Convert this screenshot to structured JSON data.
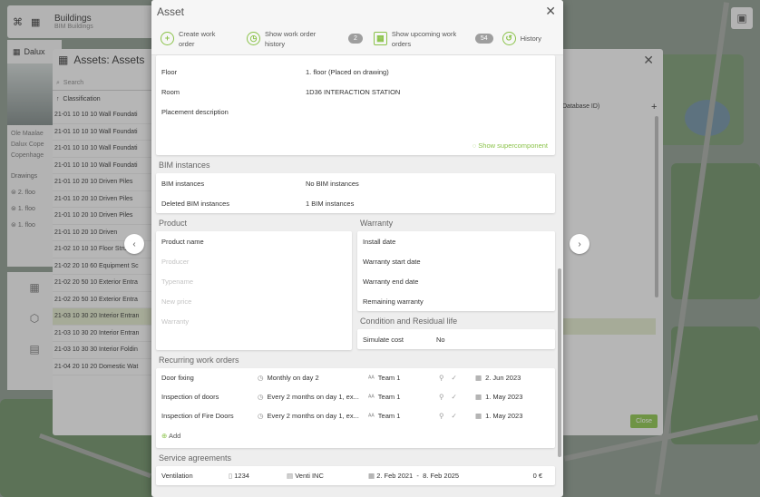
{
  "app": {
    "building_title": "Buildings",
    "building_subtitle": "BIM Buildings"
  },
  "left_panel": {
    "title": "Dalux",
    "info_lines": [
      "Ole Maalae",
      "Dalux Cope",
      "Copenhage"
    ],
    "drawings_label": "Drawings",
    "drawing_items": [
      "2. floo",
      "1. floo",
      "1. floo"
    ]
  },
  "assets_panel": {
    "title": "Assets: Assets",
    "search_placeholder": "Search",
    "column_classification": "Classification",
    "column_db": "Database ID)",
    "close_label": "Close",
    "rows": [
      "21-01 10 10 10 Wall Foundati",
      "21-01 10 10 10 Wall Foundati",
      "21-01 10 10 10 Wall Foundati",
      "21-01 10 10 10 Wall Foundati",
      "21-01 10 20 10 Driven Piles",
      "21-01 10 20 10 Driven Piles",
      "21-01 10 20 10 Driven Piles",
      "21-01 10 20 10 Driven",
      "21-02 10 10 10 Floor Structur",
      "21-02 20 10 60 Equipment Sc",
      "21-02 20 50 10 Exterior Entra",
      "21-02 20 50 10 Exterior Entra",
      "21-03 10 30 20 Interior Entran",
      "21-03 10 30 20 Interior Entran",
      "21-03 10 30 30 Interior Foldin",
      "21-04 20 10 20 Domestic Wat"
    ],
    "selected_row_index": 12
  },
  "modal": {
    "title": "Asset",
    "actions": {
      "create_wo": "Create work order",
      "show_history": "Show work order history",
      "history_count": "2",
      "upcoming": "Show upcoming work orders",
      "upcoming_count": "54",
      "history": "History"
    },
    "placement": {
      "floor_label": "Floor",
      "floor_value": "1. floor (Placed on drawing)",
      "room_label": "Room",
      "room_value": "1D36 INTERACTION STATION",
      "desc_label": "Placement description",
      "supercomponent_link": "Show supercomponent"
    },
    "bim": {
      "title": "BIM instances",
      "rows": [
        {
          "k": "BIM instances",
          "v": "No BIM instances"
        },
        {
          "k": "Deleted BIM instances",
          "v": "1 BIM instances"
        }
      ]
    },
    "product": {
      "title": "Product",
      "name_label": "Product name",
      "placeholders": [
        "Producer",
        "Typename",
        "New price",
        "Warranty"
      ]
    },
    "warranty": {
      "title": "Warranty",
      "rows": [
        "Install date",
        "Warranty start date",
        "Warranty end date",
        "Remaining warranty"
      ]
    },
    "condition": {
      "title": "Condition and Residual life",
      "label": "Simulate cost",
      "value": "No"
    },
    "recurring": {
      "title": "Recurring work orders",
      "rows": [
        {
          "name": "Door fixing",
          "schedule": "Monthly on day 2",
          "team": "Team 1",
          "date": "2. Jun 2023"
        },
        {
          "name": "Inspection of doors",
          "schedule": "Every 2 months on day 1, ex...",
          "team": "Team 1",
          "date": "1. May 2023"
        },
        {
          "name": "Inspection of Fire Doors",
          "schedule": "Every 2 months on day 1, ex...",
          "team": "Team 1",
          "date": "1. May 2023"
        }
      ],
      "add_label": "Add"
    },
    "service": {
      "title": "Service agreements",
      "name": "Ventilation",
      "number": "1234",
      "company": "Venti INC",
      "start": "2. Feb 2021",
      "dash": "-",
      "end": "8. Feb 2025",
      "amount": "0 €"
    }
  },
  "colors": {
    "accent": "#8bc34a",
    "selected_row": "#dfe7c9"
  }
}
